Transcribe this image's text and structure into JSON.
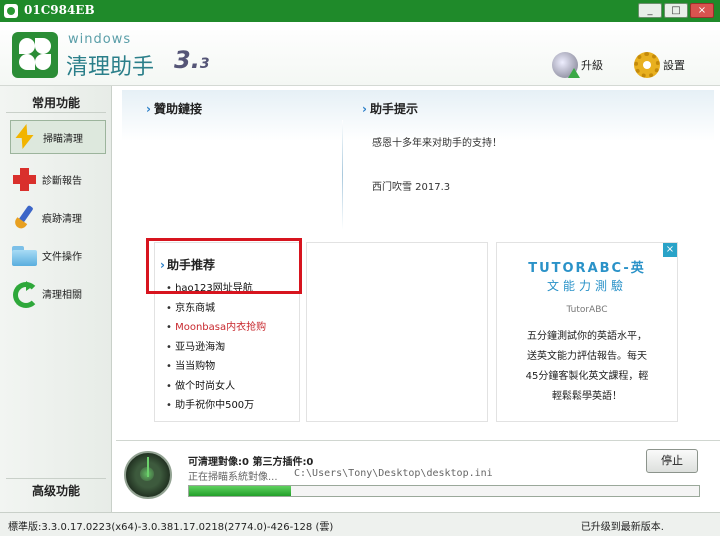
{
  "window": {
    "title": "01C984EB",
    "min_label": "_",
    "max_label": "□",
    "close_label": "×"
  },
  "brand": {
    "small": "windows",
    "big": "清理助手",
    "version_major": "3.",
    "version_minor": "3"
  },
  "header": {
    "upgrade_label": "升級",
    "settings_label": "設置"
  },
  "sidebar": {
    "head": "常用功能",
    "items": [
      {
        "label": "掃瞄清理"
      },
      {
        "label": "診斷報告"
      },
      {
        "label": "痕跡清理"
      },
      {
        "label": "文件操作"
      },
      {
        "label": "清理相關"
      }
    ],
    "foot": "高级功能"
  },
  "main": {
    "sponsor_title": "贊助鏈接",
    "notice_title": "助手提示",
    "notice_line1": "感恩十多年来对助手的支持！",
    "notice_line2": "西门吹雪 2017.3",
    "recommend_title": "助手推荐",
    "links": [
      {
        "text": "hao123网址导航"
      },
      {
        "text": "京东商城"
      },
      {
        "text": "Moonbasa内衣抢购"
      },
      {
        "text": "亚马逊海淘"
      },
      {
        "text": "当当购物"
      },
      {
        "text": "做个时尚女人"
      },
      {
        "text": "助手祝你中500万"
      }
    ],
    "ad": {
      "close": "×",
      "title": "TUTORABC-英",
      "subtitle": "文能力測驗",
      "brand": "TutorABC",
      "line1": "五分鐘測試你的英語水平，",
      "line2": "送英文能力評估報告。每天",
      "line3": "45分鐘客製化英文課程，輕",
      "line4": "輕鬆鬆學英語！"
    }
  },
  "scan": {
    "count_text": "可清理對像:0  第三方插件:0",
    "status_text": "正在掃瞄系統對像...",
    "path_text": "C:\\Users\\Tony\\Desktop\\desktop.ini",
    "progress": 0.2,
    "stop_label": "停止"
  },
  "statusbar": {
    "left": "標準版:3.3.0.17.0223(x64)-3.0.381.17.0218(2774.0)-426-128 (雲)",
    "right": "已升级到最新版本."
  },
  "colors": {
    "brand_green": "#1f8a2a",
    "highlight_red": "#d7141e",
    "progress_green": "#23a02a",
    "ad_blue": "#2a92c8"
  }
}
